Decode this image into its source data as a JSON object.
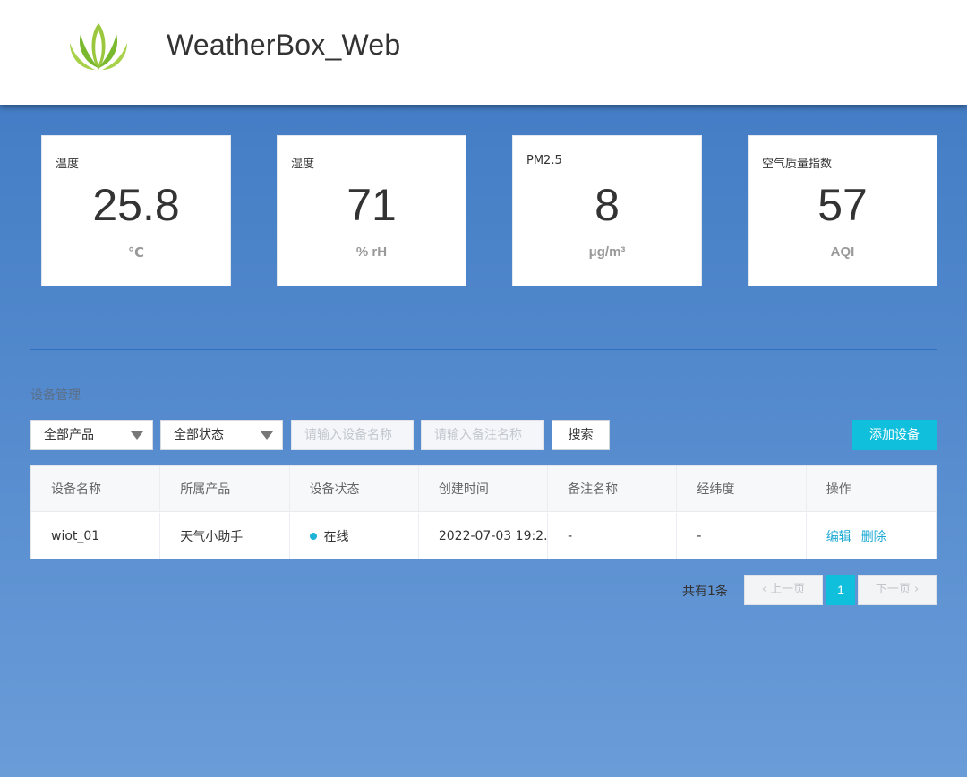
{
  "header": {
    "app_title": "WeatherBox_Web",
    "logo_color": "#7ab82e"
  },
  "cards": [
    {
      "label": "温度",
      "value": "25.8",
      "unit": "℃"
    },
    {
      "label": "湿度",
      "value": "71",
      "unit": "% rH"
    },
    {
      "label": "PM2.5",
      "value": "8",
      "unit": "μg/m³"
    },
    {
      "label": "空气质量指数",
      "value": "57",
      "unit": "AQI"
    }
  ],
  "device_section": {
    "title": "设备管理",
    "filters": {
      "product_select": "全部产品",
      "status_select": "全部状态",
      "device_name_placeholder": "请输入设备名称",
      "remark_placeholder": "请输入备注名称",
      "search_label": "搜索",
      "add_label": "添加设备"
    },
    "table": {
      "headers": [
        "设备名称",
        "所属产品",
        "设备状态",
        "创建时间",
        "备注名称",
        "经纬度",
        "操作"
      ],
      "rows": [
        {
          "device_name": "wiot_01",
          "product": "天气小助手",
          "status": "在线",
          "created": "2022-07-03 19:2...",
          "remark": "-",
          "coords": "-",
          "edit": "编辑",
          "delete": "删除"
        }
      ]
    },
    "pagination": {
      "total": "共有1条",
      "prev": "上一页",
      "current": "1",
      "next": "下一页"
    }
  },
  "colors": {
    "accent": "#0fbfdc",
    "online_dot": "#1cb3d6",
    "link": "#19a9d4"
  }
}
